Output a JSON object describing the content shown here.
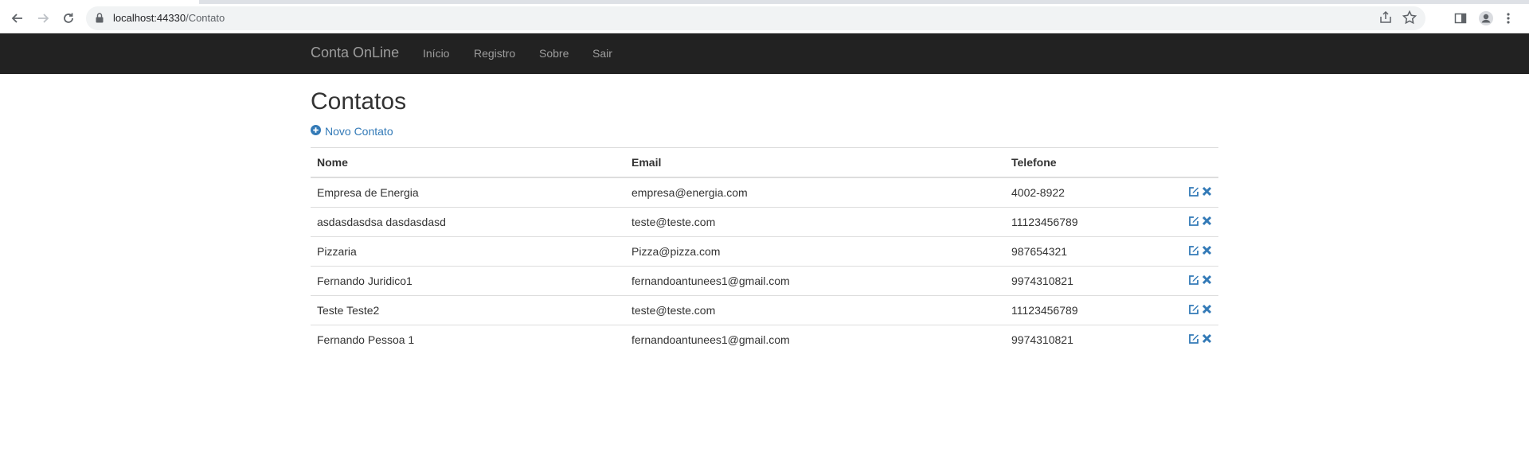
{
  "browser": {
    "url_host": "localhost:44330",
    "url_path": "/Contato"
  },
  "navbar": {
    "brand": "Conta OnLine",
    "links": [
      "Início",
      "Registro",
      "Sobre",
      "Sair"
    ]
  },
  "page": {
    "title": "Contatos",
    "new_contact_label": "Novo Contato"
  },
  "table": {
    "headers": [
      "Nome",
      "Email",
      "Telefone"
    ],
    "rows": [
      {
        "nome": "Empresa de Energia",
        "email": "empresa@energia.com",
        "telefone": "4002-8922"
      },
      {
        "nome": "asdasdasdsa dasdasdasd",
        "email": "teste@teste.com",
        "telefone": "11123456789"
      },
      {
        "nome": "Pizzaria",
        "email": "Pizza@pizza.com",
        "telefone": "987654321"
      },
      {
        "nome": "Fernando Juridico1",
        "email": "fernandoantunees1@gmail.com",
        "telefone": "9974310821"
      },
      {
        "nome": "Teste Teste2",
        "email": "teste@teste.com",
        "telefone": "11123456789"
      },
      {
        "nome": "Fernando Pessoa 1",
        "email": "fernandoantunees1@gmail.com",
        "telefone": "9974310821"
      }
    ]
  },
  "colors": {
    "navbar_bg": "#222222",
    "link": "#337ab7",
    "icon": "#337ab7"
  },
  "icons": {
    "row_actions": [
      "edit-icon",
      "delete-icon"
    ]
  }
}
